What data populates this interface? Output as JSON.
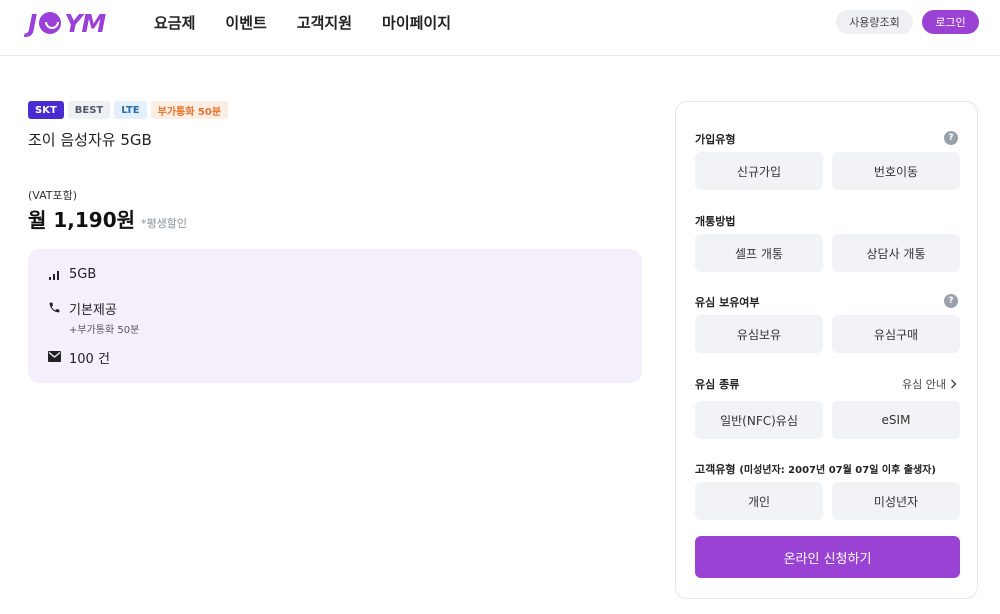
{
  "header": {
    "logo": "JOYM",
    "nav": [
      "요금제",
      "이벤트",
      "고객지원",
      "마이페이지"
    ],
    "usage_label": "사용량조회",
    "login_label": "로그인"
  },
  "plan": {
    "tags": [
      "SKT",
      "BEST",
      "LTE",
      "부가통화 50분"
    ],
    "name": "조이 음성자유 5GB",
    "vat_label": "(VAT포함)",
    "price": "월 1,190원",
    "discount_note": "*평생할인",
    "benefits": {
      "data": "5GB",
      "call": "기본제공",
      "call_sub": "+부가통화 50분",
      "sms": "100 건"
    }
  },
  "panel": {
    "join_type": {
      "title": "가입유형",
      "options": [
        "신규가입",
        "번호이동"
      ]
    },
    "activation": {
      "title": "개통방법",
      "options": [
        "셀프 개통",
        "상담사 개통"
      ]
    },
    "usim_owned": {
      "title": "유심 보유여부",
      "options": [
        "유심보유",
        "유심구매"
      ]
    },
    "usim_type": {
      "title": "유심 종류",
      "guide": "유심 안내",
      "options": [
        "일반(NFC)유심",
        "eSIM"
      ]
    },
    "customer_type": {
      "title": "고객유형",
      "note": "(미성년자: 2007년 07월 07일 이후 출생자)",
      "options": [
        "개인",
        "미성년자"
      ]
    },
    "help_symbol": "?",
    "apply_label": "온라인 신청하기"
  },
  "colors": {
    "brand": "#9a42d3",
    "skt": "#4a2bd1",
    "benefit_bg": "#f5effc"
  },
  "icons": [
    "signal-icon",
    "phone-icon",
    "mail-icon",
    "help-icon",
    "chevron-right-icon"
  ]
}
